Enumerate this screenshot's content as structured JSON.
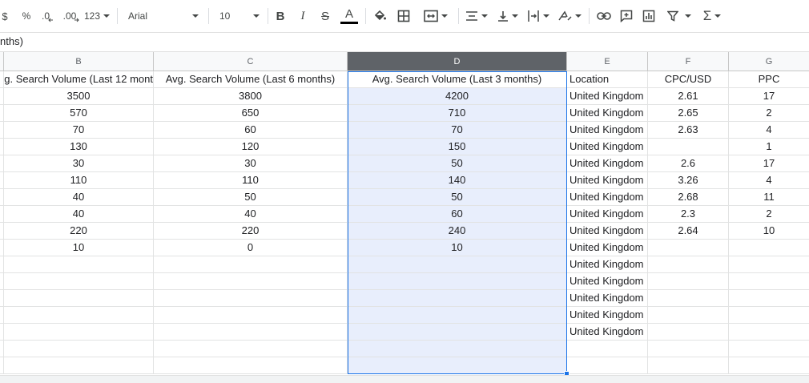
{
  "toolbar": {
    "currency": "$",
    "percent": "%",
    "dec_decrease": ".0",
    "dec_increase": ".00",
    "more_formats": "123",
    "font_name": "Arial",
    "font_size": "10",
    "bold": "B",
    "italic": "I",
    "strike": "S",
    "text_color": "A",
    "sum_symbol": "Σ"
  },
  "formula_bar": {
    "text": "nths)"
  },
  "columns": [
    {
      "letter": "B"
    },
    {
      "letter": "C"
    },
    {
      "letter": "D",
      "selected": true
    },
    {
      "letter": "E"
    },
    {
      "letter": "F"
    },
    {
      "letter": "G"
    }
  ],
  "headers": {
    "B": "g. Search Volume (Last 12 mont",
    "C": "Avg. Search Volume (Last 6 months)",
    "D": "Avg. Search Volume (Last 3 months)",
    "E": "Location",
    "F": "CPC/USD",
    "G": "PPC"
  },
  "rows": [
    {
      "B": "3500",
      "C": "3800",
      "D": "4200",
      "E": "United Kingdom",
      "F": "2.61",
      "G": "17"
    },
    {
      "B": "570",
      "C": "650",
      "D": "710",
      "E": "United Kingdom",
      "F": "2.65",
      "G": "2"
    },
    {
      "B": "70",
      "C": "60",
      "D": "70",
      "E": "United Kingdom",
      "F": "2.63",
      "G": "4"
    },
    {
      "B": "130",
      "C": "120",
      "D": "150",
      "E": "United Kingdom",
      "F": "",
      "G": "1"
    },
    {
      "B": "30",
      "C": "30",
      "D": "50",
      "E": "United Kingdom",
      "F": "2.6",
      "G": "17"
    },
    {
      "B": "110",
      "C": "110",
      "D": "140",
      "E": "United Kingdom",
      "F": "3.26",
      "G": "4"
    },
    {
      "B": "40",
      "C": "50",
      "D": "50",
      "E": "United Kingdom",
      "F": "2.68",
      "G": "11"
    },
    {
      "B": "40",
      "C": "40",
      "D": "60",
      "E": "United Kingdom",
      "F": "2.3",
      "G": "2"
    },
    {
      "B": "220",
      "C": "220",
      "D": "240",
      "E": "United Kingdom",
      "F": "2.64",
      "G": "10"
    },
    {
      "B": "10",
      "C": "0",
      "D": "10",
      "E": "United Kingdom",
      "F": "",
      "G": ""
    },
    {
      "B": "",
      "C": "",
      "D": "",
      "E": "United Kingdom",
      "F": "",
      "G": ""
    },
    {
      "B": "",
      "C": "",
      "D": "",
      "E": "United Kingdom",
      "F": "",
      "G": ""
    },
    {
      "B": "",
      "C": "",
      "D": "",
      "E": "United Kingdom",
      "F": "",
      "G": ""
    },
    {
      "B": "",
      "C": "",
      "D": "",
      "E": "United Kingdom",
      "F": "",
      "G": ""
    },
    {
      "B": "",
      "C": "",
      "D": "",
      "E": "United Kingdom",
      "F": "",
      "G": ""
    },
    {
      "B": "",
      "C": "",
      "D": "",
      "E": "",
      "F": "",
      "G": ""
    },
    {
      "B": "",
      "C": "",
      "D": "",
      "E": "",
      "F": "",
      "G": ""
    }
  ],
  "colors": {
    "selection": "#1a73e8",
    "selected_fill": "#e8eefc",
    "selected_header": "#5f6368"
  }
}
